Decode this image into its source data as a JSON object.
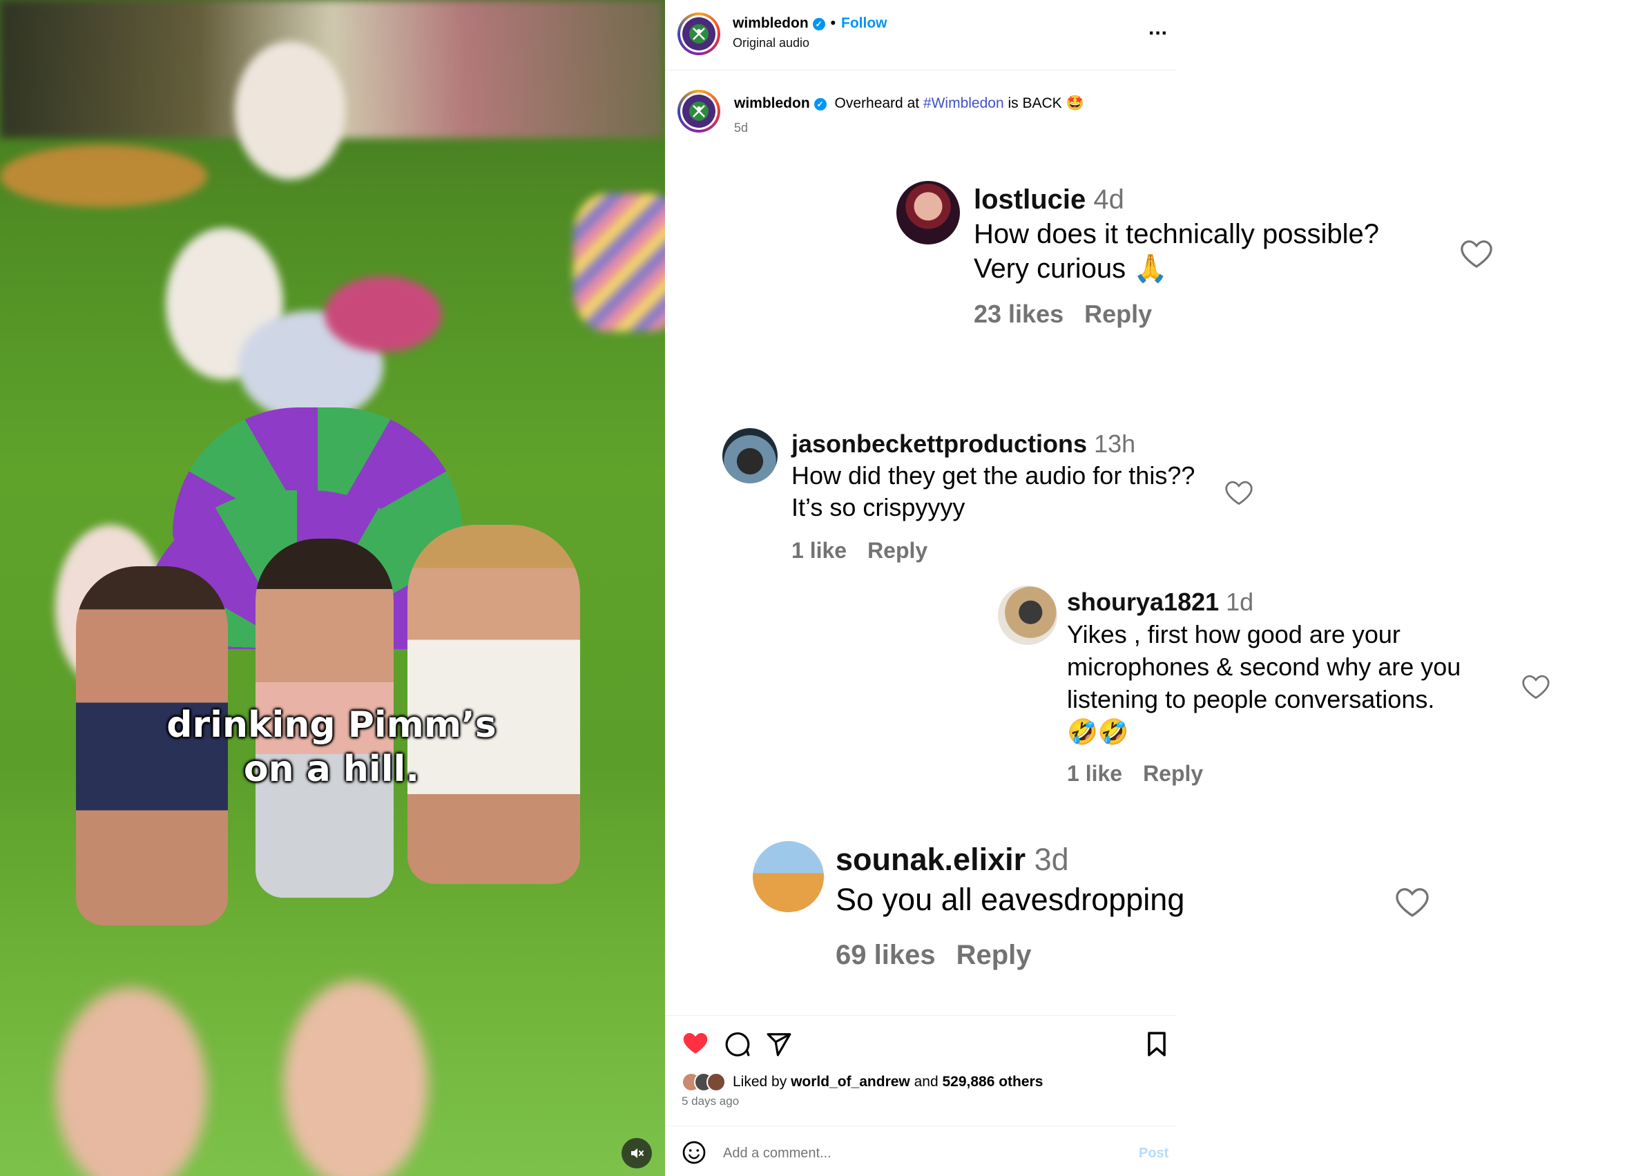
{
  "video": {
    "caption_line1": "drinking Pimm’s",
    "caption_line2": "on a hill.",
    "mute_icon": "speaker-muted-icon"
  },
  "header": {
    "username": "wimbledon",
    "separator": "•",
    "follow_label": "Follow",
    "subtitle": "Original audio",
    "more_label": "..."
  },
  "post": {
    "username": "wimbledon",
    "text_before": "Overheard at ",
    "hashtag": "#Wimbledon",
    "text_after": " is BACK 🤩",
    "time": "5d"
  },
  "comments": [
    {
      "username": "lostlucie",
      "time": "4d",
      "line1": "How does it technically possible?",
      "line2": "Very curious 🙏",
      "likes": "23 likes",
      "reply": "Reply"
    },
    {
      "username": "jasonbeckettproductions",
      "time": "13h",
      "line1": "How did they get the audio for this??",
      "line2": "It’s so crispyyyy",
      "likes": "1 like",
      "reply": "Reply"
    },
    {
      "username": "shourya1821",
      "time": "1d",
      "line1": "Yikes , first how good are your",
      "line2": "microphones & second why are you",
      "line3": "listening to people conversations.",
      "line4": "🤣🤣",
      "likes": "1 like",
      "reply": "Reply"
    },
    {
      "username": "sounak.elixir",
      "time": "3d",
      "line1": "So you all eavesdropping",
      "likes": "69 likes",
      "reply": "Reply"
    }
  ],
  "actions": {
    "liked_prefix": "Liked by ",
    "liked_user": "world_of_andrew",
    "liked_and": " and ",
    "liked_count": "529,886 others",
    "ago": "5 days ago",
    "comment_placeholder": "Add a comment...",
    "post_label": "Post"
  },
  "colors": {
    "accent_blue": "#0095f6",
    "hashtag": "#4150c8",
    "like_red": "#ff3040",
    "muted_text": "#737373"
  }
}
